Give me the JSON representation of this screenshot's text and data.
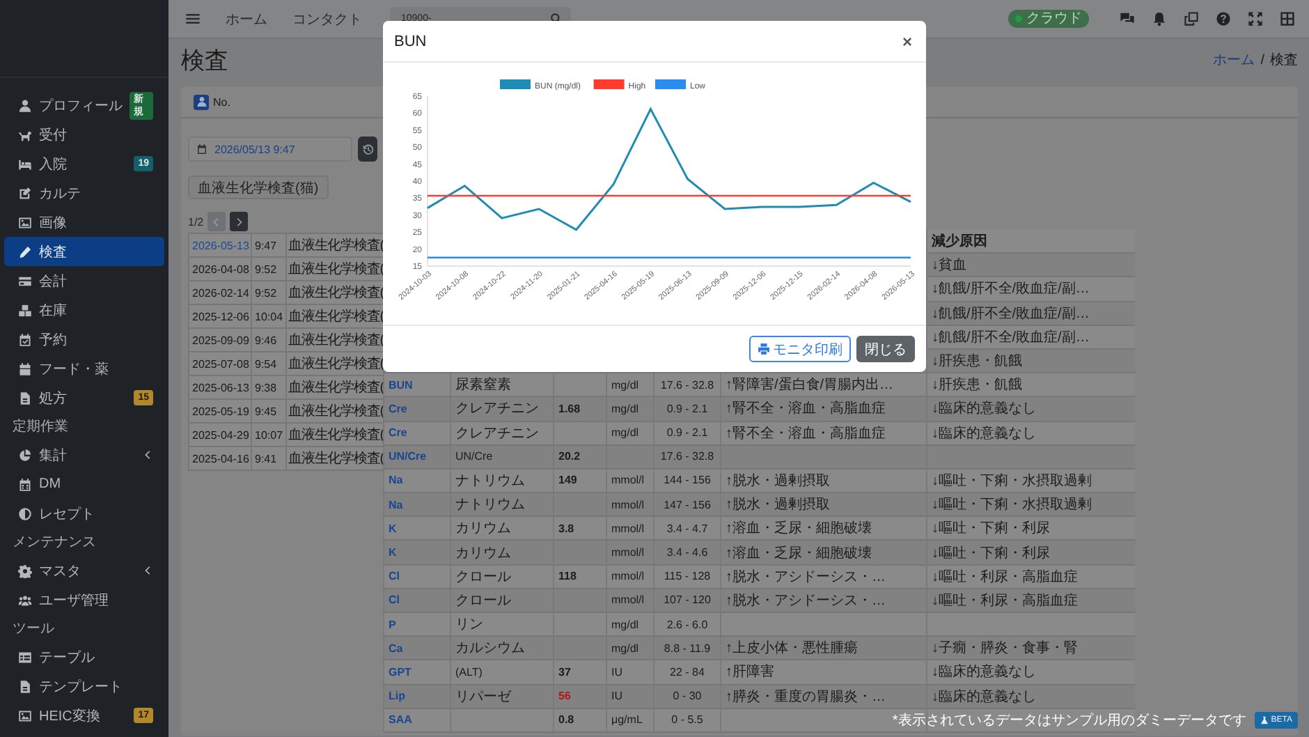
{
  "sidebar": {
    "items": [
      {
        "kind": "item",
        "label": "プロフィール",
        "selected": false,
        "expandable": false,
        "badge": {
          "text": "新規",
          "color": "#1c6a3a"
        }
      },
      {
        "kind": "item",
        "label": "受付",
        "selected": false,
        "expandable": false
      },
      {
        "kind": "item",
        "label": "入院",
        "selected": false,
        "expandable": false,
        "badge": {
          "text": "19",
          "color": "#145f6c"
        }
      },
      {
        "kind": "item",
        "label": "カルテ",
        "selected": false,
        "expandable": false
      },
      {
        "kind": "item",
        "label": "画像",
        "selected": false,
        "expandable": false
      },
      {
        "kind": "item",
        "label": "検査",
        "selected": true,
        "expandable": false
      },
      {
        "kind": "item",
        "label": "会計",
        "selected": false,
        "expandable": false
      },
      {
        "kind": "item",
        "label": "在庫",
        "selected": false,
        "expandable": false
      },
      {
        "kind": "item",
        "label": "予約",
        "selected": false,
        "expandable": false
      },
      {
        "kind": "item",
        "label": "フード・薬",
        "selected": false,
        "expandable": false
      },
      {
        "kind": "item",
        "label": "処方",
        "selected": false,
        "expandable": false,
        "badge": {
          "text": "15",
          "color": "#b3882c"
        }
      },
      {
        "kind": "header",
        "label": "定期作業"
      },
      {
        "kind": "item",
        "label": "集計",
        "selected": false,
        "expandable": true
      },
      {
        "kind": "item",
        "label": "DM",
        "selected": false,
        "expandable": false
      },
      {
        "kind": "item",
        "label": "レセプト",
        "selected": false,
        "expandable": false
      },
      {
        "kind": "header",
        "label": "メンテナンス"
      },
      {
        "kind": "item",
        "label": "マスタ",
        "selected": false,
        "expandable": true
      },
      {
        "kind": "item",
        "label": "ユーザ管理",
        "selected": false,
        "expandable": false
      },
      {
        "kind": "header",
        "label": "ツール"
      },
      {
        "kind": "item",
        "label": "テーブル",
        "selected": false,
        "expandable": false
      },
      {
        "kind": "item",
        "label": "テンプレート",
        "selected": false,
        "expandable": false
      },
      {
        "kind": "item",
        "label": "HEIC変換",
        "selected": false,
        "expandable": false,
        "badge": {
          "text": "17",
          "color": "#b3882c"
        }
      }
    ]
  },
  "top_bar": {
    "nav_links": [
      "ホーム",
      "コンタクト"
    ],
    "search": {
      "value": "10900-"
    },
    "status": {
      "label": "クラウド"
    }
  },
  "page": {
    "title": "検査",
    "breadcrumb": [
      {
        "label": "ホーム",
        "link": true
      },
      {
        "label": "検査",
        "link": false
      }
    ],
    "breadcrumb_separator": "/"
  },
  "record": {
    "header_label": "No.",
    "date_field": {
      "value": "2026/05/13 9:47"
    },
    "exam_button": "血液生化学検査(猫)",
    "pagination": {
      "label": "1/2",
      "prev_disabled": true,
      "next_disabled": false
    }
  },
  "exam_list": {
    "rows": [
      {
        "date": "2026-05-13",
        "time": "9:47",
        "test": "血液生化学検査(",
        "selected": true
      },
      {
        "date": "2026-04-08",
        "time": "9:52",
        "test": "血液生化学検査(",
        "selected": false
      },
      {
        "date": "2026-02-14",
        "time": "9:52",
        "test": "血液生化学検査(",
        "selected": false
      },
      {
        "date": "2025-12-06",
        "time": "10:04",
        "test": "血液生化学検査(",
        "selected": false
      },
      {
        "date": "2025-09-09",
        "time": "9:46",
        "test": "血液生化学検査(",
        "selected": false
      },
      {
        "date": "2025-07-08",
        "time": "9:54",
        "test": "血液生化学検査(",
        "selected": false
      },
      {
        "date": "2025-06-13",
        "time": "9:38",
        "test": "血液生化学検査(",
        "selected": false
      },
      {
        "date": "2025-05-19",
        "time": "9:45",
        "test": "血液生化学検査(",
        "selected": false
      },
      {
        "date": "2025-04-29",
        "time": "10:07",
        "test": "血液生化学検査(",
        "selected": false
      },
      {
        "date": "2025-04-16",
        "time": "9:41",
        "test": "血液生化学検査(",
        "selected": false
      }
    ]
  },
  "results_table": {
    "decrease_header": "減少原因",
    "rows": [
      {
        "decrease": "↓貧血"
      },
      {
        "decrease": "↓飢餓/肝不全/敗血症/副…"
      },
      {
        "decrease": "↓飢餓/肝不全/敗血症/副…"
      },
      {
        "decrease": "↓飢餓/肝不全/敗血症/副…"
      },
      {
        "decrease": "↓肝疾患・飢餓"
      },
      {
        "code": "BUN",
        "name": "尿素窒素",
        "unit": "mg/dl",
        "range": "17.6 - 32.8",
        "increase": "↑腎障害/蛋白食/胃腸内出…",
        "decrease": "↓肝疾患・飢餓"
      },
      {
        "code": "Cre",
        "name": "クレアチニン",
        "value": "1.68",
        "unit": "mg/dl",
        "range": "0.9 - 2.1",
        "increase": "↑腎不全・溶血・高脂血症",
        "decrease": "↓臨床的意義なし",
        "abnormal": false
      },
      {
        "code": "Cre",
        "name": "クレアチニン",
        "unit": "mg/dl",
        "range": "0.9 - 2.1",
        "increase": "↑腎不全・溶血・高脂血症",
        "decrease": "↓臨床的意義なし"
      },
      {
        "code": "UN/Cre",
        "name": "UN/Cre",
        "value": "20.2",
        "range": "17.6 - 32.8",
        "abnormal": false
      },
      {
        "code": "Na",
        "name": "ナトリウム",
        "value": "149",
        "unit": "mmol/l",
        "range": "144 - 156",
        "increase": "↑脱水・過剰摂取",
        "decrease": "↓嘔吐・下痢・水摂取過剰",
        "abnormal": false
      },
      {
        "code": "Na",
        "name": "ナトリウム",
        "unit": "mmol/l",
        "range": "147 - 156",
        "increase": "↑脱水・過剰摂取",
        "decrease": "↓嘔吐・下痢・水摂取過剰"
      },
      {
        "code": "K",
        "name": "カリウム",
        "value": "3.8",
        "unit": "mmol/l",
        "range": "3.4 - 4.7",
        "increase": "↑溶血・乏尿・細胞破壊",
        "decrease": "↓嘔吐・下痢・利尿",
        "abnormal": false
      },
      {
        "code": "K",
        "name": "カリウム",
        "unit": "mmol/l",
        "range": "3.4 - 4.6",
        "increase": "↑溶血・乏尿・細胞破壊",
        "decrease": "↓嘔吐・下痢・利尿"
      },
      {
        "code": "Cl",
        "name": "クロール",
        "value": "118",
        "unit": "mmol/l",
        "range": "115 - 128",
        "increase": "↑脱水・アシドーシス・…",
        "decrease": "↓嘔吐・利尿・高脂血症",
        "abnormal": false
      },
      {
        "code": "Cl",
        "name": "クロール",
        "unit": "mmol/l",
        "range": "107 - 120",
        "increase": "↑脱水・アシドーシス・…",
        "decrease": "↓嘔吐・利尿・高脂血症"
      },
      {
        "code": "P",
        "name": "リン",
        "unit": "mg/dl",
        "range": "2.6 - 6.0"
      },
      {
        "code": "Ca",
        "name": "カルシウム",
        "unit": "mg/dl",
        "range": "8.8 - 11.9",
        "increase": "↑上皮小体・悪性腫瘍",
        "decrease": "↓子癇・膵炎・食事・腎"
      },
      {
        "code": "GPT",
        "name": "(ALT)",
        "value": "37",
        "unit": "IU",
        "range": "22 - 84",
        "increase": "↑肝障害",
        "decrease": "↓臨床的意義なし",
        "abnormal": false
      },
      {
        "code": "Lip",
        "name": "リパーゼ",
        "value": "56",
        "unit": "IU",
        "range": "0 - 30",
        "increase": "↑膵炎・重度の胃腸炎・…",
        "decrease": "↓臨床的意義なし",
        "abnormal": true
      },
      {
        "code": "SAA",
        "value": "0.8",
        "unit": "μg/mL",
        "range": "0 - 5.5",
        "abnormal": false
      }
    ]
  },
  "modal": {
    "title": "BUN",
    "close": "×",
    "chart_data": {
      "type": "line",
      "categories": [
        "2024-10-03",
        "2024-10-08",
        "2024-10-22",
        "2024-11-20",
        "2025-01-21",
        "2025-04-16",
        "2025-05-19",
        "2025-06-13",
        "2025-09-09",
        "2025-12-06",
        "2025-12-15",
        "2026-02-14",
        "2026-04-08",
        "2026-05-13"
      ],
      "series": [
        {
          "name": "BUN (mg/dl)",
          "color": "#1f8db3",
          "values": [
            32.1,
            38.6,
            29.1,
            31.8,
            25.7,
            39.0,
            61.2,
            40.6,
            31.8,
            32.4,
            32.4,
            33.0,
            39.5,
            33.9
          ]
        },
        {
          "name": "High",
          "color": "#ff3b2f",
          "values": [
            35.7,
            35.7,
            35.7,
            35.7,
            35.7,
            35.7,
            35.7,
            35.7,
            35.7,
            35.7,
            35.7,
            35.7,
            35.7,
            35.7
          ]
        },
        {
          "name": "Low",
          "color": "#2b8cf0",
          "values": [
            17.5,
            17.5,
            17.5,
            17.5,
            17.5,
            17.5,
            17.5,
            17.5,
            17.5,
            17.5,
            17.5,
            17.5,
            17.5,
            17.5
          ]
        }
      ],
      "ylim": [
        15,
        65
      ],
      "legend": "top",
      "yticks": [
        15,
        20,
        25,
        30,
        35,
        40,
        45,
        50,
        55,
        60,
        65
      ]
    },
    "buttons": [
      {
        "kind": "print",
        "label": "モニタ印刷"
      },
      {
        "kind": "close",
        "label": "閉じる"
      }
    ]
  },
  "notice": {
    "text": "*表示されているデータはサンプル用のダミーデータです",
    "badge": "BETA"
  }
}
